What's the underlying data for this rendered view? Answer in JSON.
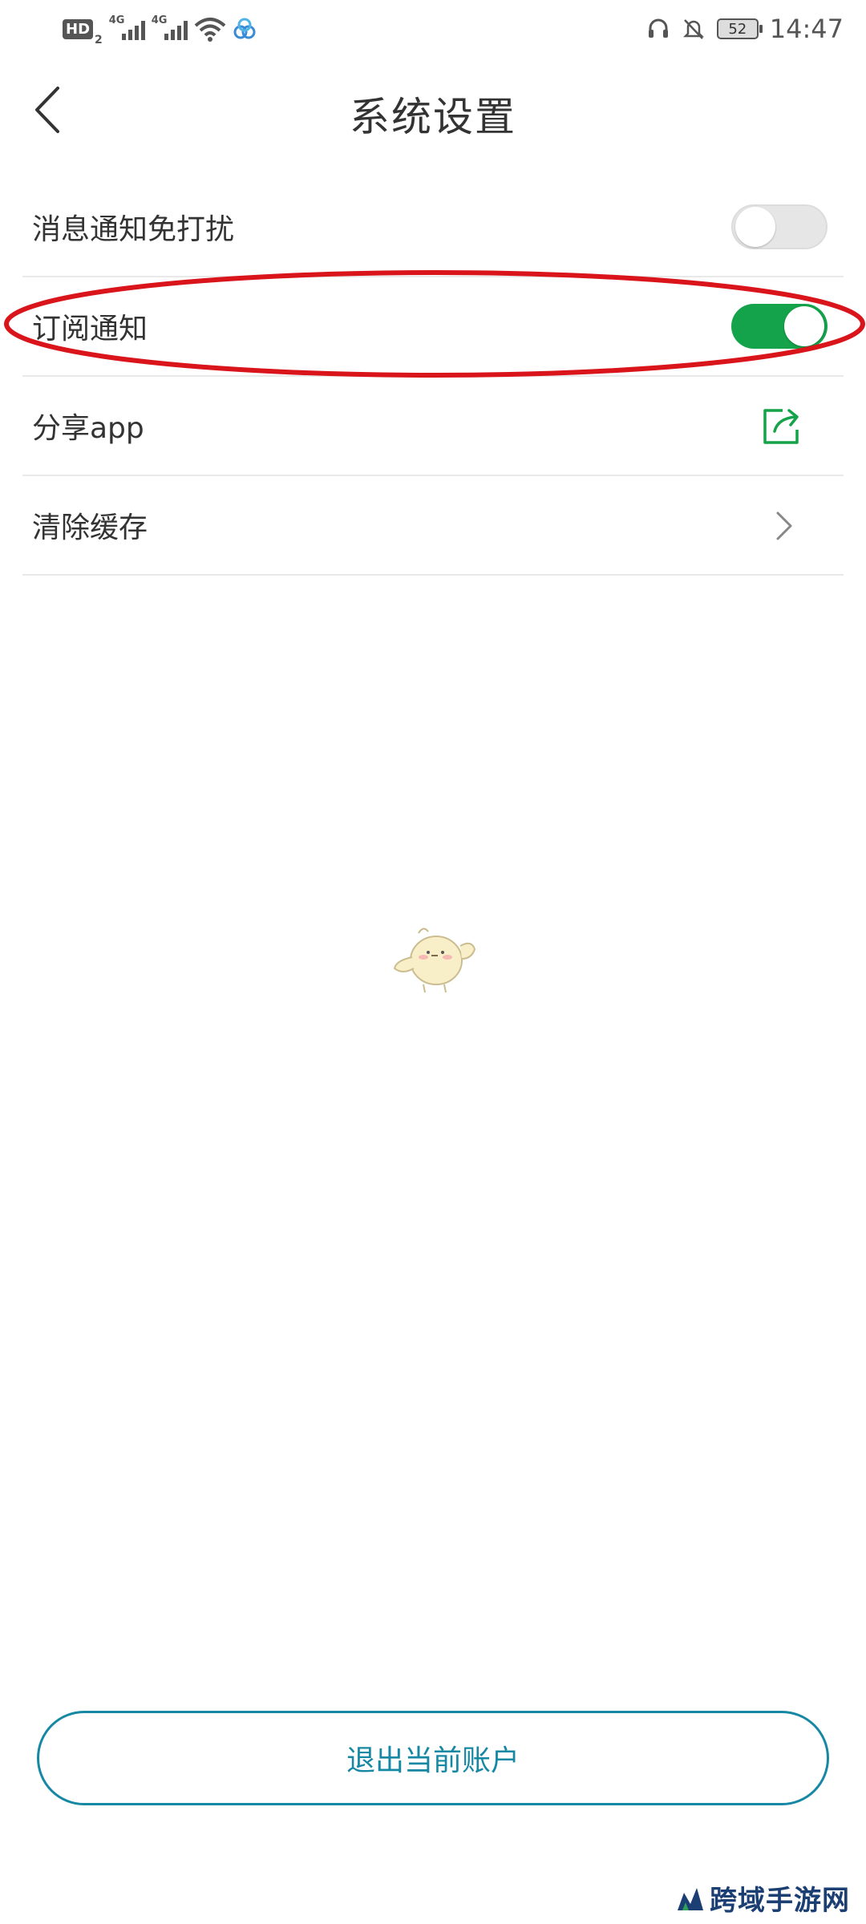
{
  "status_bar": {
    "hd_label": "HD",
    "hd_sub": "2",
    "sim1_type": "4G",
    "sim2_type": "4G",
    "battery": "52",
    "time": "14:47"
  },
  "header": {
    "title": "系统设置"
  },
  "settings": {
    "items": [
      {
        "label": "消息通知免打扰",
        "control": "toggle",
        "state": "off"
      },
      {
        "label": "订阅通知",
        "control": "toggle",
        "state": "on"
      },
      {
        "label": "分享app",
        "control": "share-icon"
      },
      {
        "label": "清除缓存",
        "control": "chevron-right-icon"
      }
    ]
  },
  "logout_label": "退出当前账户",
  "watermark": {
    "text": "跨域手游网"
  },
  "colors": {
    "toggle_on": "#14a24a",
    "toggle_off": "#e6e6e6",
    "accent": "#1788a3",
    "share_icon": "#14a24a",
    "highlight": "#d9151b"
  }
}
